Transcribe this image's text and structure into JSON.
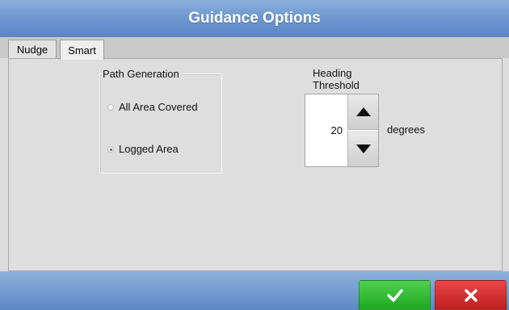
{
  "window": {
    "title": "Guidance Options"
  },
  "tabs": [
    {
      "label": "Nudge",
      "selected": false
    },
    {
      "label": "Smart",
      "selected": true
    }
  ],
  "path_generation": {
    "legend": "Path Generation",
    "options": [
      {
        "label": "All Area Covered",
        "selected": false
      },
      {
        "label": "Logged Area",
        "selected": true
      }
    ]
  },
  "heading_threshold": {
    "label_line1": "Heading",
    "label_line2": "Threshold",
    "value": "20",
    "unit": "degrees"
  },
  "colors": {
    "title_bar": "#6f98cf",
    "ok_button": "#2fb82f",
    "cancel_button": "#d03030"
  },
  "icons": {
    "ok": "check-icon",
    "cancel": "x-icon",
    "increment": "triangle-up-icon",
    "decrement": "triangle-down-icon"
  }
}
